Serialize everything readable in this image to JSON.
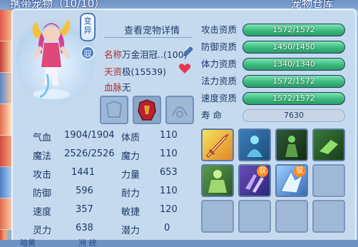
{
  "header": {
    "left_title": "携带宠物（10/10）",
    "right_title": "宠物仓库"
  },
  "pet": {
    "variant_badge": "变异",
    "bound_badge": "驭",
    "details_link": "查看宠物详情",
    "name_label": "名称",
    "name_value": "万金泪冠..(100)",
    "talent_label": "天资",
    "talent_value": "极(15539)",
    "bloodline_label": "血脉",
    "bloodline_value": "无"
  },
  "stats": [
    {
      "label": "气血",
      "value": "1904/1904",
      "label2": "体质",
      "value2": "110"
    },
    {
      "label": "魔法",
      "value": "2526/2526",
      "label2": "魔力",
      "value2": "110"
    },
    {
      "label": "攻击",
      "value": "1441",
      "label2": "力量",
      "value2": "653"
    },
    {
      "label": "防御",
      "value": "596",
      "label2": "耐力",
      "value2": "110"
    },
    {
      "label": "速度",
      "value": "357",
      "label2": "敏捷",
      "value2": "120"
    },
    {
      "label": "灵力",
      "value": "638",
      "label2": "潜力",
      "value2": "0"
    }
  ],
  "aptitudes": [
    {
      "label": "攻击资质",
      "text": "1572/1572",
      "fill": 1.0
    },
    {
      "label": "防御资质",
      "text": "1450/1450",
      "fill": 1.0
    },
    {
      "label": "体力资质",
      "text": "1340/1340",
      "fill": 1.0
    },
    {
      "label": "法力资质",
      "text": "1572/1572",
      "fill": 1.0
    },
    {
      "label": "速度资质",
      "text": "1572/1572",
      "fill": 1.0
    }
  ],
  "lifespan": {
    "label": "寿    命",
    "value": "7630"
  },
  "skills": [
    {
      "name": "sword-skill-icon",
      "badge": ""
    },
    {
      "name": "spirit-skill-icon",
      "badge": ""
    },
    {
      "name": "guard-skill-icon",
      "badge": ""
    },
    {
      "name": "dash-skill-icon",
      "badge": ""
    },
    {
      "name": "strength-skill-icon",
      "badge": ""
    },
    {
      "name": "claw-skill-icon",
      "badge": "驭"
    },
    {
      "name": "ice-skill-icon",
      "badge": "驭"
    },
    {
      "name": "empty-slot",
      "badge": ""
    },
    {
      "name": "empty-slot",
      "badge": ""
    },
    {
      "name": "empty-slot",
      "badge": ""
    },
    {
      "name": "empty-slot",
      "badge": ""
    },
    {
      "name": "empty-slot",
      "badge": ""
    }
  ],
  "bottom": {
    "left": "暗黄",
    "mid": "洲 统"
  },
  "colors": {
    "accent": "#3cba7e",
    "panel": "#c6daef",
    "label_red": "#b02a2a"
  }
}
